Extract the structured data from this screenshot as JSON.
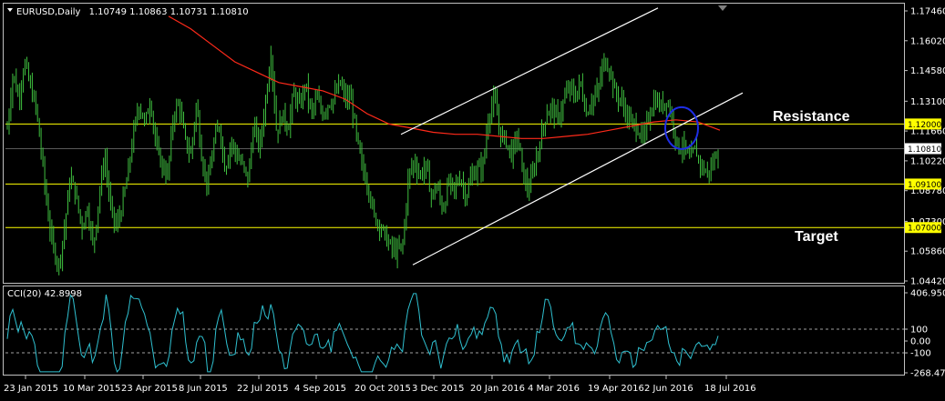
{
  "header": {
    "symbol": "EURUSD,Daily",
    "ohlc": "1.10749 1.10863 1.10731 1.10810"
  },
  "cci_header": "CCI(20) 42.8998",
  "colors": {
    "background": "#000000",
    "border": "#c0c0c0",
    "candles": "#3fbf3f",
    "moving_average": "#ff2a1a",
    "level_lines": "#ffff00",
    "channel": "#ffffff",
    "cci_line": "#2fc0d0",
    "circle": "#1e2ee6",
    "current_price_tag": "#ffffff",
    "level_tag": "#ffff00"
  },
  "annotations": {
    "resistance": "Resistance",
    "target": "Target"
  },
  "chart_data": [
    {
      "type": "candlestick",
      "symbol": "EURUSD",
      "timeframe": "Daily",
      "ylim": [
        1.0442,
        1.1746
      ],
      "y_ticks": [
        "1.17460",
        "1.16020",
        "1.14580",
        "1.13100",
        "1.11660",
        "1.10220",
        "1.08780",
        "1.07300",
        "1.05860",
        "1.04420"
      ],
      "current_price": "1.10810",
      "x_ticks": [
        "23 Jan 2015",
        "10 Mar 2015",
        "23 Apr 2015",
        "8 Jun 2015",
        "22 Jul 2015",
        "4 Sep 2015",
        "20 Oct 2015",
        "3 Dec 2015",
        "20 Jan 2016",
        "4 Mar 2016",
        "19 Apr 2016",
        "2 Jun 2016",
        "18 Jul 2016"
      ],
      "levels": [
        {
          "value": 1.12,
          "label": "1.12000"
        },
        {
          "value": 1.091,
          "label": "1.09100"
        },
        {
          "value": 1.07,
          "label": "1.07000"
        }
      ],
      "close_path": [
        1.118,
        1.145,
        1.132,
        1.15,
        1.138,
        1.128,
        1.105,
        1.078,
        1.06,
        1.052,
        1.07,
        1.095,
        1.085,
        1.07,
        1.08,
        1.06,
        1.085,
        1.105,
        1.08,
        1.07,
        1.08,
        1.095,
        1.115,
        1.13,
        1.12,
        1.132,
        1.108,
        1.1,
        1.095,
        1.125,
        1.13,
        1.112,
        1.105,
        1.13,
        1.102,
        1.09,
        1.11,
        1.12,
        1.098,
        1.112,
        1.105,
        1.1,
        1.093,
        1.12,
        1.108,
        1.13,
        1.155,
        1.115,
        1.125,
        1.118,
        1.135,
        1.128,
        1.14,
        1.125,
        1.132,
        1.125,
        1.13,
        1.132,
        1.14,
        1.132,
        1.132,
        1.112,
        1.098,
        1.09,
        1.075,
        1.072,
        1.065,
        1.06,
        1.058,
        1.062,
        1.095,
        1.102,
        1.095,
        1.1,
        1.085,
        1.09,
        1.078,
        1.092,
        1.088,
        1.095,
        1.085,
        1.095,
        1.098,
        1.1,
        1.125,
        1.132,
        1.115,
        1.112,
        1.105,
        1.115,
        1.095,
        1.088,
        1.1,
        1.112,
        1.125,
        1.128,
        1.122,
        1.13,
        1.138,
        1.133,
        1.14,
        1.125,
        1.132,
        1.135,
        1.15,
        1.148,
        1.135,
        1.132,
        1.125,
        1.12,
        1.118,
        1.112,
        1.125,
        1.132,
        1.128,
        1.132,
        1.123,
        1.108,
        1.11,
        1.102,
        1.108,
        1.1,
        1.096,
        1.1,
        1.108
      ],
      "moving_average_path": [
        1.172,
        1.166,
        1.158,
        1.15,
        1.145,
        1.14,
        1.138,
        1.136,
        1.132,
        1.125,
        1.12,
        1.118,
        1.116,
        1.115,
        1.115,
        1.114,
        1.113,
        1.113,
        1.114,
        1.115,
        1.117,
        1.119,
        1.121,
        1.122,
        1.121,
        1.117
      ],
      "channel": [
        {
          "name": "upper",
          "start": [
            "3 Dec 2015",
            1.115
          ],
          "end": [
            "7 Jun 2016",
            1.176
          ]
        },
        {
          "name": "lower",
          "start": [
            "3 Dec 2015",
            1.052
          ],
          "end": [
            "18 Jul 2016",
            1.135
          ]
        }
      ],
      "circle": {
        "date": "2 Jun 2016",
        "value": 1.118
      }
    },
    {
      "type": "line",
      "name": "CCI(20)",
      "ylim": [
        -268.4785,
        406.9509
      ],
      "y_ticks": [
        "406.9509",
        "100",
        "0.00",
        "-100",
        "-268.4785"
      ],
      "reference_levels": [
        100,
        -100
      ],
      "current_value": 42.8998
    }
  ]
}
